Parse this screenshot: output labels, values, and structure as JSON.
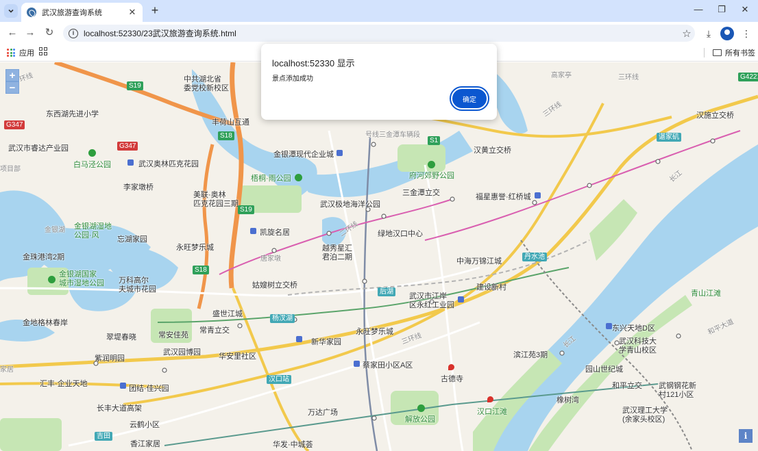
{
  "browser": {
    "tab_title": "武汉旅游查询系统",
    "url": "localhost:52330/23武汉旅游查询系统.html",
    "bookmarks": {
      "apps_label": "应用",
      "all_bookmarks_label": "所有书签"
    }
  },
  "dialog": {
    "title": "localhost:52330 显示",
    "message": "景点添加成功",
    "ok_label": "确定"
  },
  "map": {
    "zoom_in": "+",
    "zoom_out": "−",
    "info": "i",
    "labels": {
      "l1": "东西湖先进小学",
      "l2": "武汉市睿达产业园",
      "l3": "白马泾公园",
      "l4": "武汉奥林匹克花园",
      "l5": "李家墩桥",
      "l6": "美联·奥林\n匹克花园三期",
      "l7": "梧桐·雨公园",
      "l8": "金银潭现代企业城",
      "l9": "中共湖北省\n委党校新校区",
      "l10": "丰荷山互通",
      "l11": "武汉极地海洋公园",
      "l12": "府河郊野公园",
      "l13": "汉黄立交桥",
      "l14": "三金潭立交",
      "l15": "福星惠誉·红桥城",
      "l16": "凯旋名居",
      "l17": "绿地汉口中心",
      "l18": "永旺梦乐城",
      "l19": "越秀星汇\n君泊二期",
      "l20": "金珠港湾2期",
      "l21": "金银湖国家\n城市湿地公园",
      "l22": "万科高尔\n夫城市花园",
      "l23": "姑嫂树立交桥",
      "l24": "中海万锦江城",
      "l25": "建设新村",
      "l26": "武汉市江岸\n区永红工业园",
      "l27": "盛世江城",
      "l28": "常青立交",
      "l29": "金地格林春岸",
      "l30": "翠堤春晓",
      "l31": "常安佳苑",
      "l32": "新华家园",
      "l33": "永旺梦乐城",
      "l34": "紫润明园",
      "l35": "武汉园博园",
      "l36": "华安里社区",
      "l37": "蔡家田小区A区",
      "l38": "滨江苑3期",
      "l39": "古德寺",
      "l40": "汇丰·企业天地",
      "l41": "团结·佳兴园",
      "l42": "长丰大道高架",
      "l43": "万达广场",
      "l44": "解放公园",
      "l45": "汉口江滩",
      "l46": "云鹤小区",
      "l47": "香江家居",
      "l48": "华发·中城荟",
      "l49": "汉施立交桥",
      "l50": "东兴天地D区",
      "l51": "武汉科技大\n学青山校区",
      "l52": "园山世纪城",
      "l53": "和平立交",
      "l54": "橡树湾",
      "l55": "武钢钢花新\n村121小区",
      "l56": "武汉理工大学\n(余家头校区)",
      "l57": "青山江滩",
      "l58": "金银湖湿地\n公园·风",
      "l59": "忘湖家园",
      "l60": "金银湖",
      "l61": "三环线",
      "l62": "三环线",
      "l63": "三环线",
      "l64": "二环线",
      "l65": "长江",
      "l66": "长江",
      "l67": "号线三金潭车辆段",
      "l68": "谌家矶",
      "l69": "项目部",
      "l70": "家居",
      "l71": "吉田",
      "l72": "和平大道",
      "l73": "高家亭",
      "l74": "汉口站",
      "l75": "杨汊湖",
      "l76": "后湖",
      "l77": "丹水池",
      "l78": "唐家墩",
      "l79": "一环线"
    },
    "road_badges": {
      "b1": "S19",
      "b2": "G347",
      "b3": "G347",
      "b4": "S18",
      "b5": "S19",
      "b6": "S18",
      "b7": "S1",
      "b8": "G4221"
    }
  }
}
